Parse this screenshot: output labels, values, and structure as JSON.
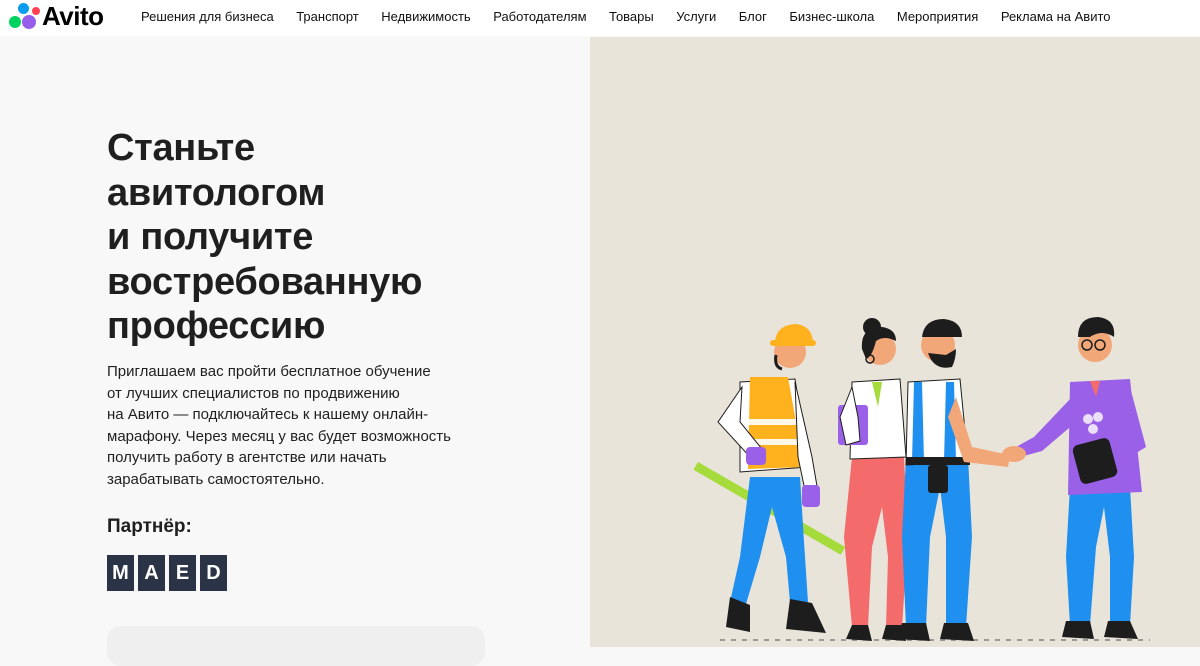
{
  "header": {
    "logo_text": "Avito",
    "nav": [
      "Решения для бизнеса",
      "Транспорт",
      "Недвижимость",
      "Работодателям",
      "Товары",
      "Услуги",
      "Блог",
      "Бизнес-школа",
      "Мероприятия",
      "Реклама на Авито"
    ]
  },
  "hero": {
    "title_lines": [
      "Станьте",
      "авитологом",
      "и получите",
      "востребованную",
      "профессию"
    ],
    "text_lines": [
      "Приглашаем вас пройти бесплатное обучение",
      "от лучших специалистов по продвижению",
      "на Авито — подключайтесь к нашему онлайн-",
      "марафону. Через месяц у вас будет возможность",
      "получить работу в агентстве или начать",
      "зарабатывать самостоятельно."
    ],
    "partner_label": "Партнёр:",
    "partner_letters": [
      "M",
      "A",
      "E",
      "D"
    ]
  },
  "illustration": {
    "icon": "team-handshake-illustration",
    "colors": {
      "background": "#e9e4d9",
      "blue": "#1f8ff0",
      "orange": "#ffb21e",
      "purple": "#9a61e8",
      "salmon": "#f36b6b",
      "green": "#a5dc3c",
      "skin": "#f2a779",
      "dark": "#1d1d1d"
    }
  }
}
